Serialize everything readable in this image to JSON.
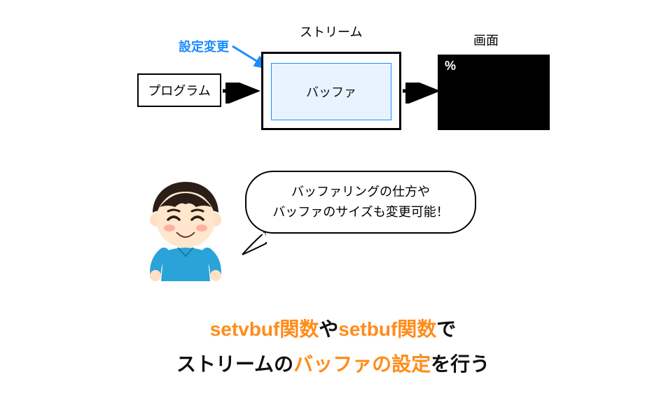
{
  "diagram": {
    "setting_change": "設定変更",
    "program": "プログラム",
    "stream_label": "ストリーム",
    "buffer": "バッファ",
    "screen_label": "画面",
    "screen_prompt": "%"
  },
  "bubble": {
    "line1": "バッファリングの仕方や",
    "line2": "バッファのサイズも変更可能！"
  },
  "caption": {
    "part1": "setvbuf関数",
    "part2": "や",
    "part3": "setbuf関数",
    "part4": "で",
    "part5": "ストリームの",
    "part6": "バッファの設定",
    "part7": "を行う"
  },
  "colors": {
    "accent_blue": "#1a8cff",
    "accent_orange": "#ff8c1a",
    "buffer_bg": "#e8f3ff"
  }
}
